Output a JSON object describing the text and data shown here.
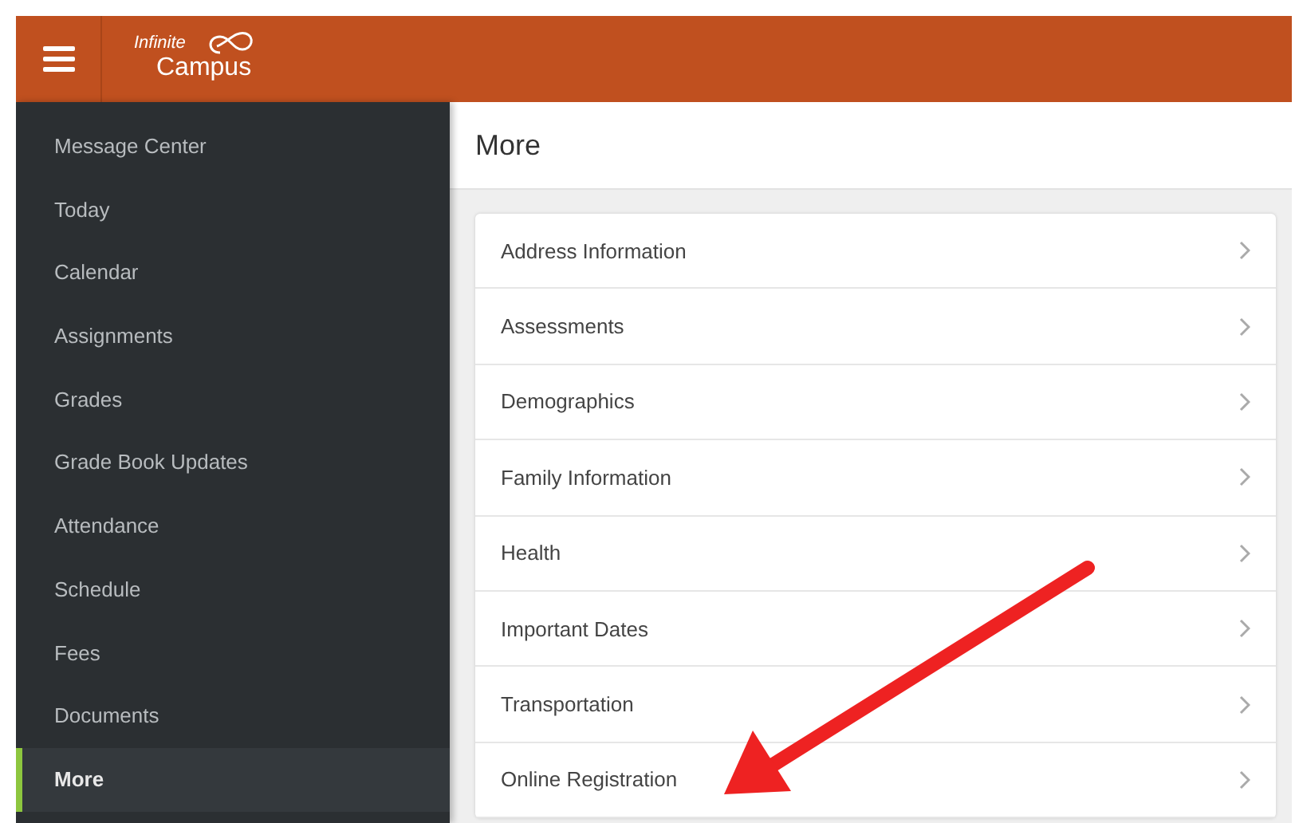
{
  "header": {
    "logo_top": "Infinite",
    "logo_bottom": "Campus"
  },
  "sidebar": {
    "items": [
      {
        "label": "Message Center",
        "selected": false
      },
      {
        "label": "Today",
        "selected": false
      },
      {
        "label": "Calendar",
        "selected": false
      },
      {
        "label": "Assignments",
        "selected": false
      },
      {
        "label": "Grades",
        "selected": false
      },
      {
        "label": "Grade Book Updates",
        "selected": false
      },
      {
        "label": "Attendance",
        "selected": false
      },
      {
        "label": "Schedule",
        "selected": false
      },
      {
        "label": "Fees",
        "selected": false
      },
      {
        "label": "Documents",
        "selected": false
      },
      {
        "label": "More",
        "selected": true
      }
    ]
  },
  "page": {
    "title": "More",
    "items": [
      "Address Information",
      "Assessments",
      "Demographics",
      "Family Information",
      "Health",
      "Important Dates",
      "Transportation",
      "Online Registration"
    ]
  }
}
